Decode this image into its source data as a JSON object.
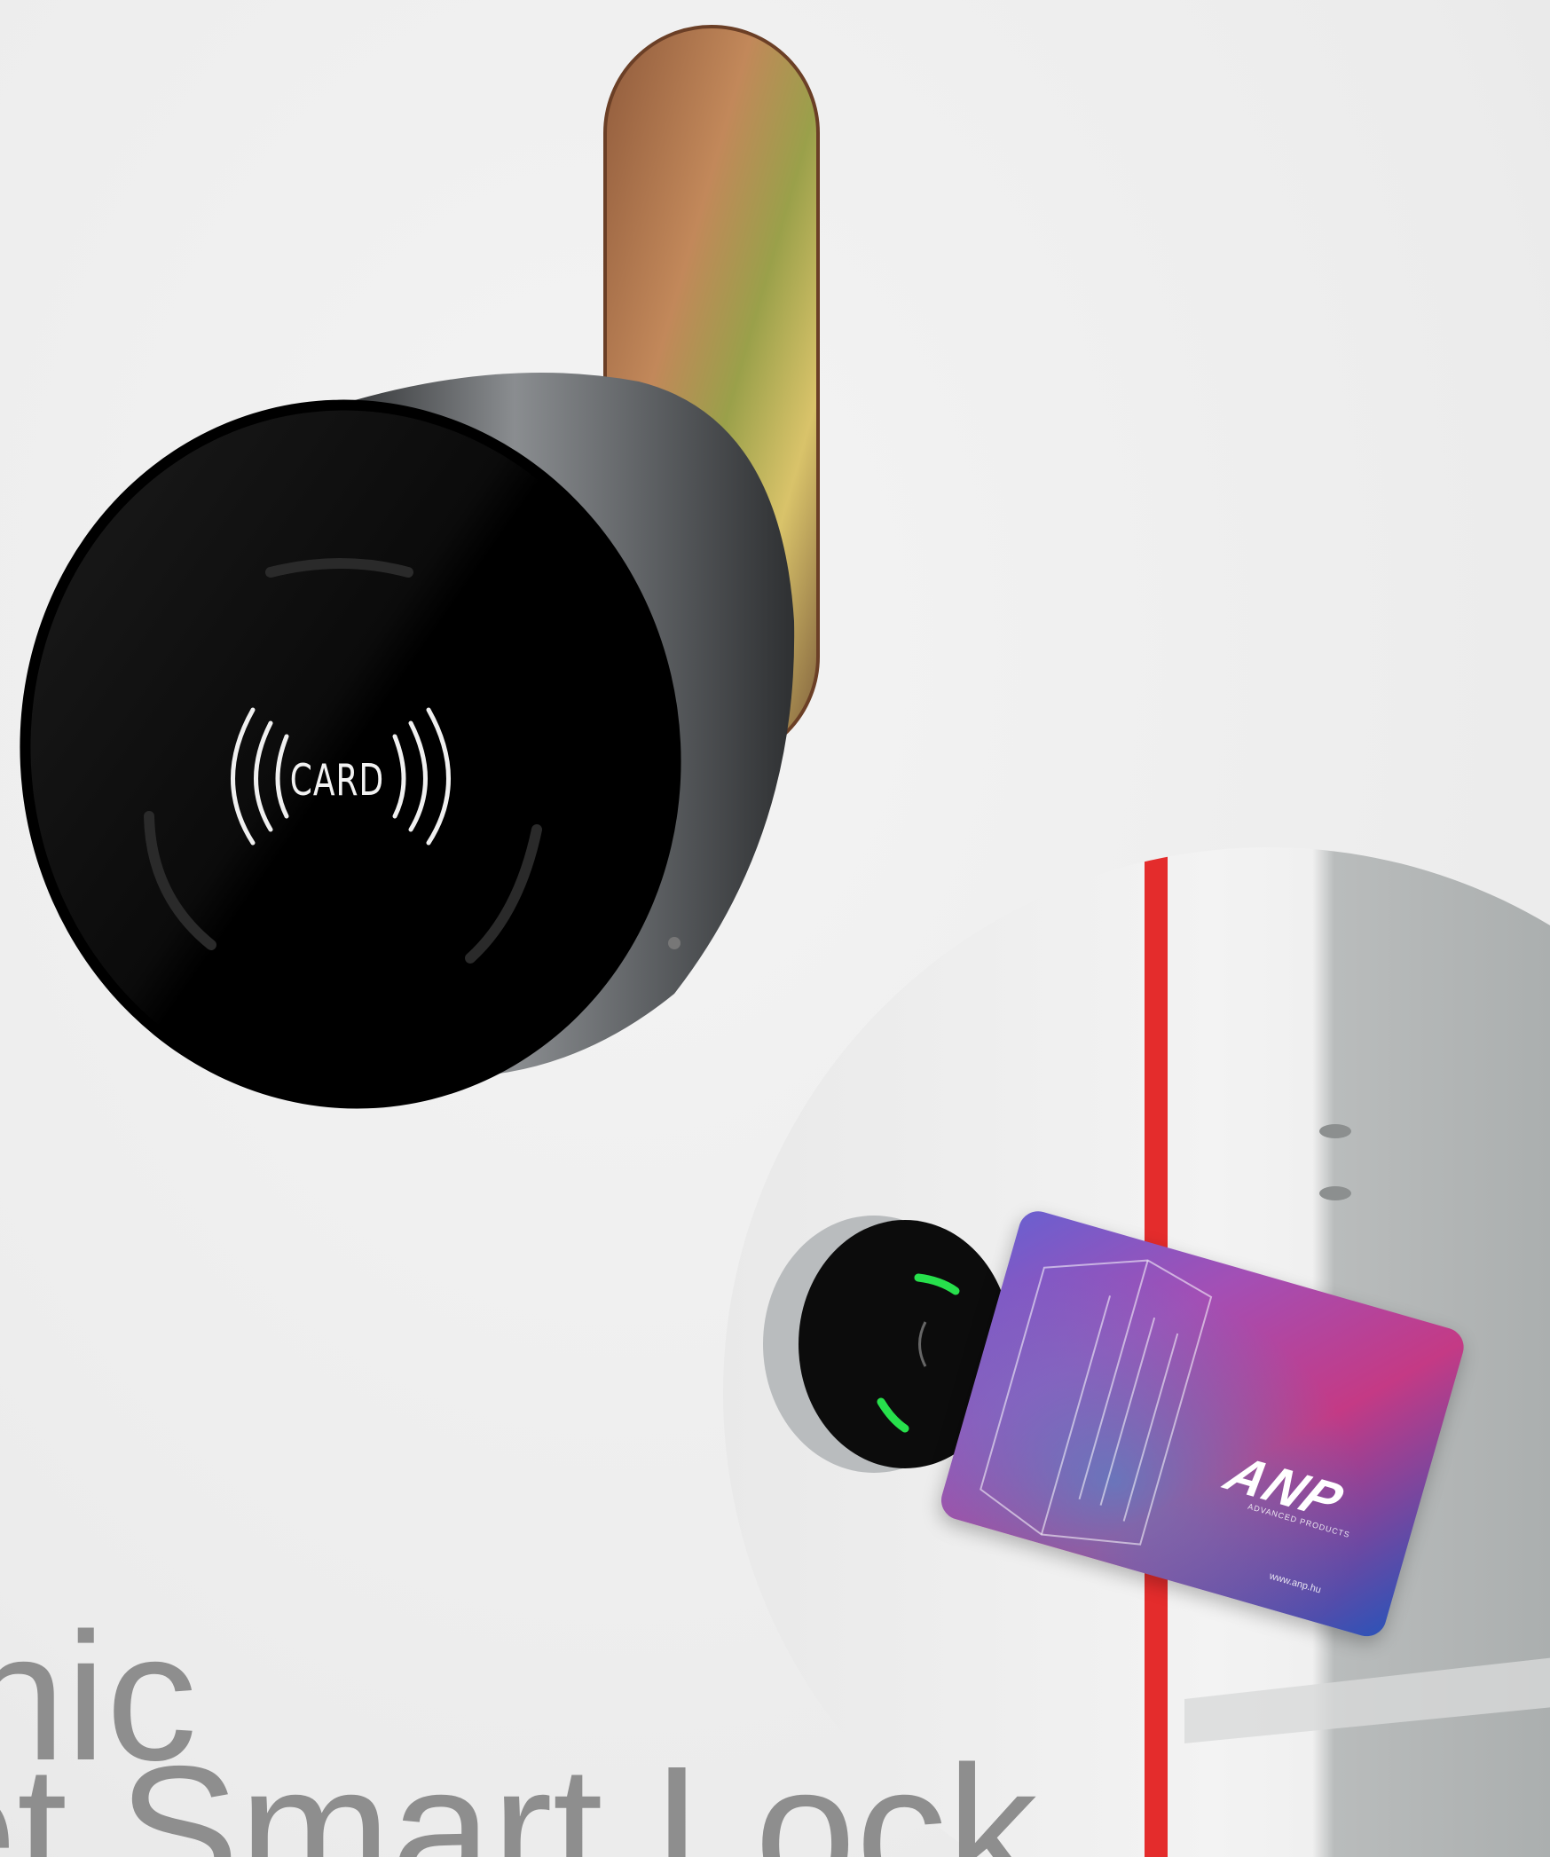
{
  "lock": {
    "badge_text": "CARD"
  },
  "access_card": {
    "logo": "ANP",
    "logo_subtext": "ADVANCED PRODUCTS",
    "url": "www.anp.hu"
  },
  "title": {
    "line1": "nic",
    "line2": "et Smart Lock"
  },
  "colors": {
    "background": "#efefef",
    "lock_face": "#050505",
    "lock_body": "#6e7173",
    "cam_bar": "#a8744a",
    "frame_red": "#e42c2c",
    "led_green": "#27e04c",
    "title_gray": "#8e8e8e"
  }
}
